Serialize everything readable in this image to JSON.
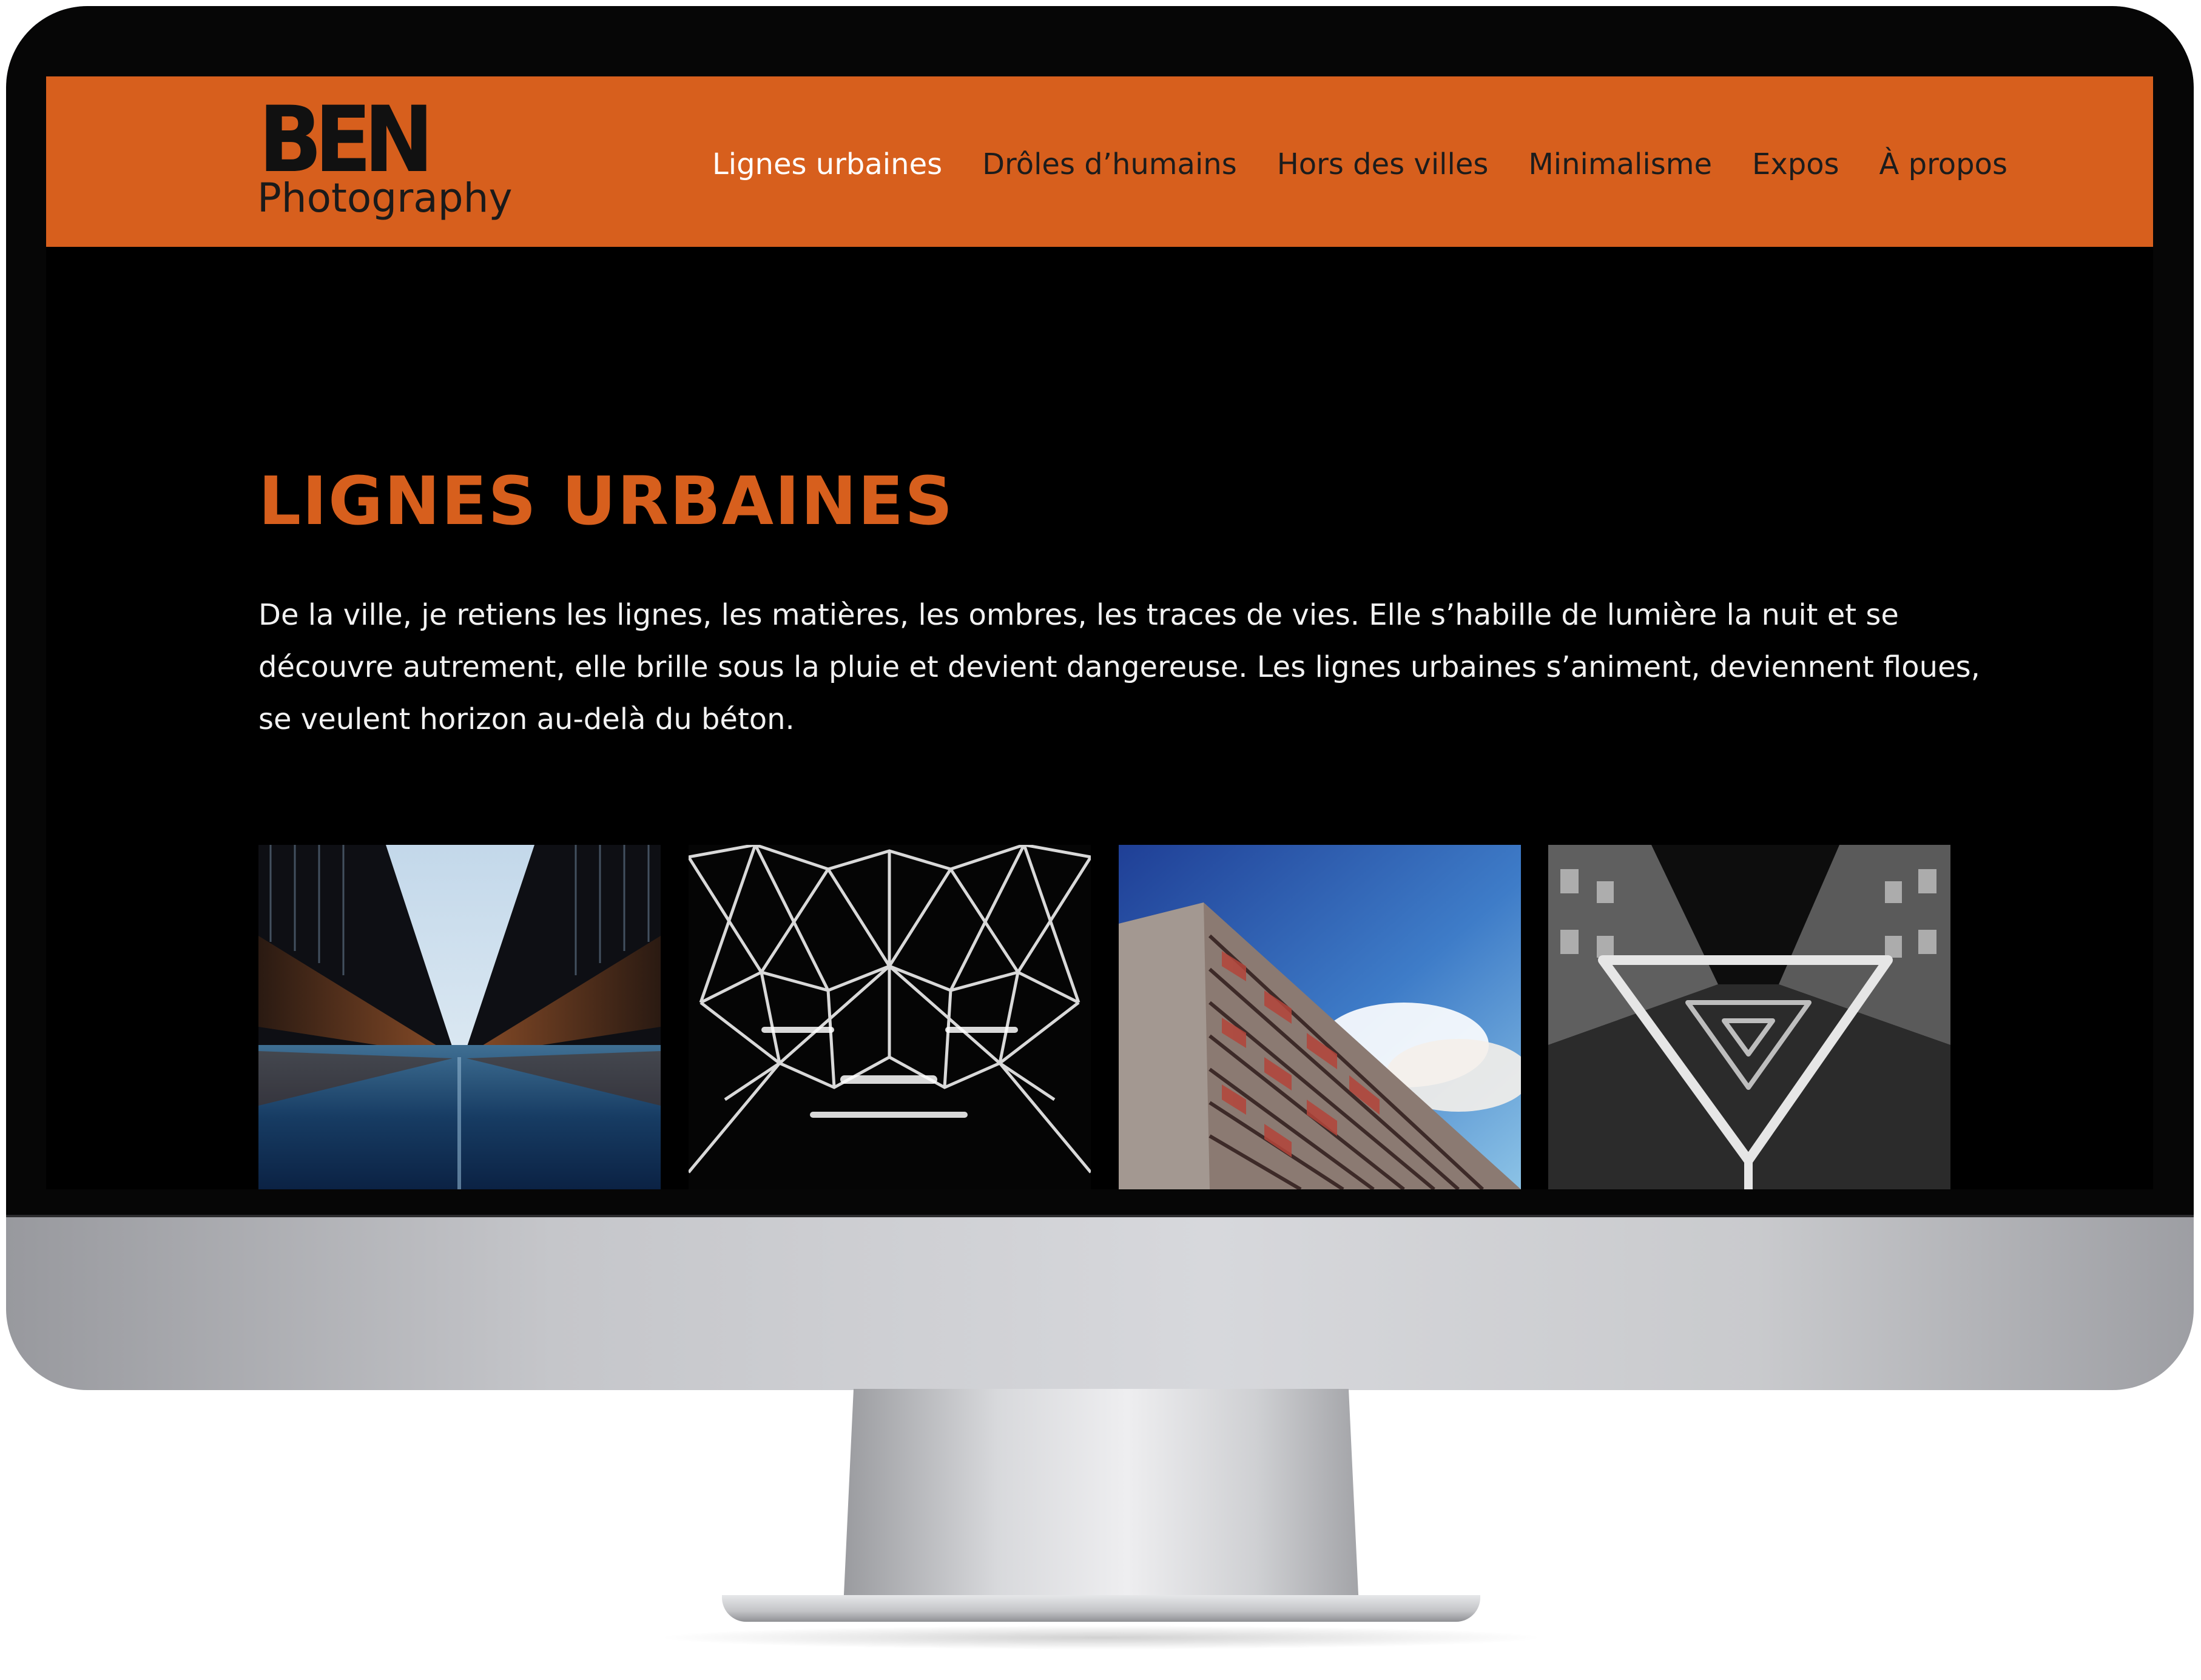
{
  "header": {
    "logo": {
      "main": "BEN",
      "sub": "Photography"
    },
    "nav": [
      "Lignes urbaines",
      "Drôles d’humains",
      "Hors des villes",
      "Minimalisme",
      "Expos",
      "À propos"
    ],
    "active_index": 0
  },
  "main": {
    "title": "LIGNES URBAINES",
    "intro": "De la ville, je retiens les lignes, les matières, les ombres, les traces de vies. Elle s’habille de lumière la nuit et se découvre autrement, elle brille sous la pluie et devient dangereuse. Les lignes urbaines s’animent, deviennent floues, se veulent horizon au-delà du béton."
  },
  "colors": {
    "accent": "#d75f1d",
    "background": "#000000",
    "text": "#f2f2f2"
  }
}
